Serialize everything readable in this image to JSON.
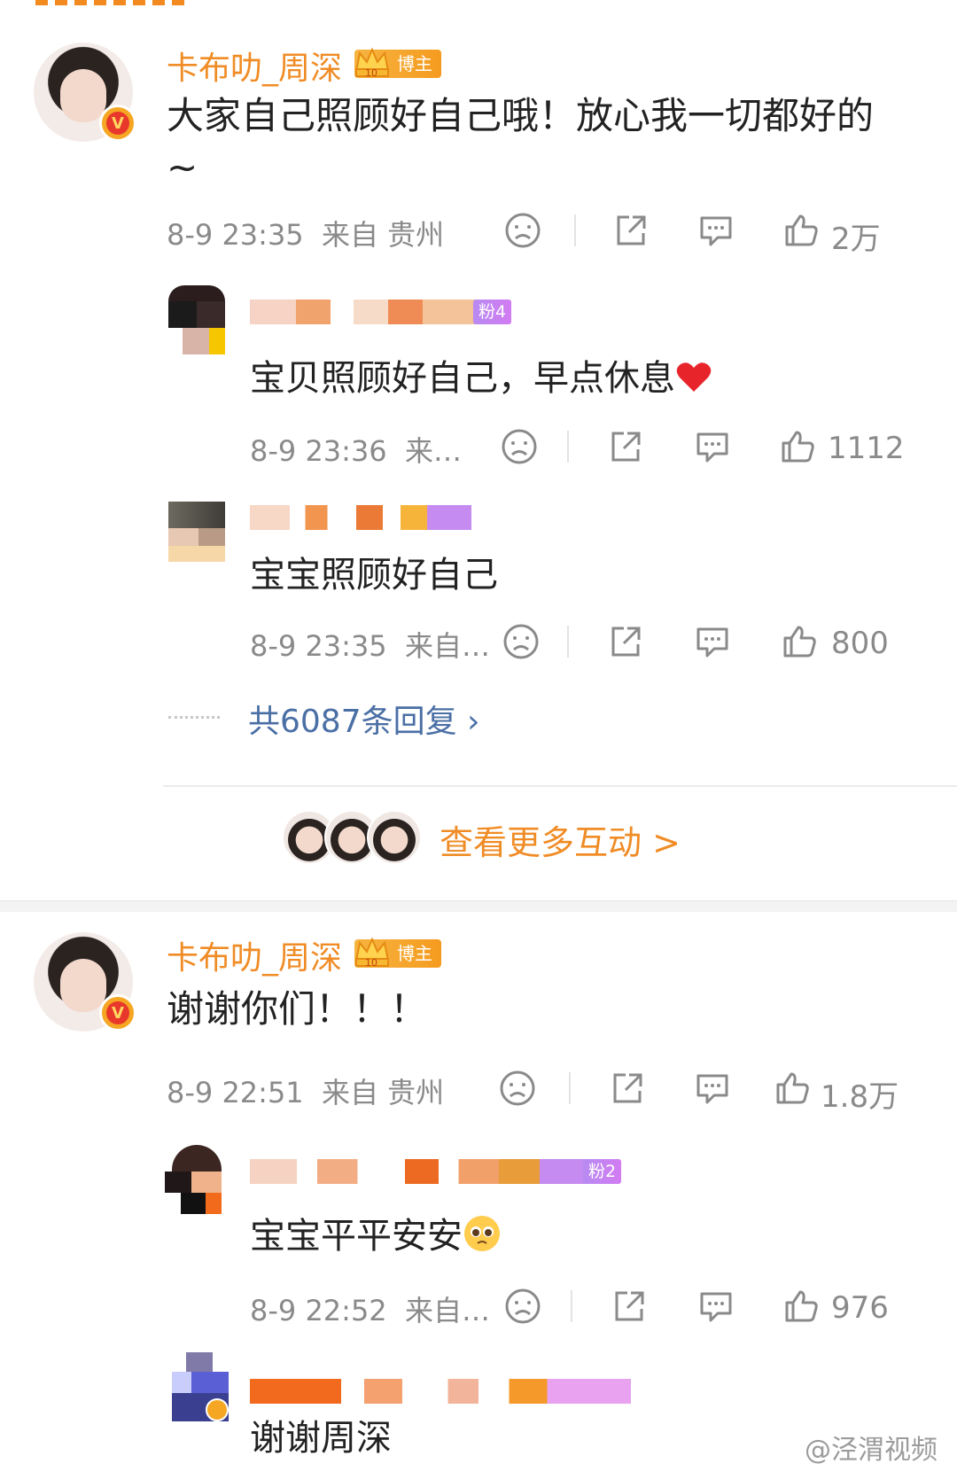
{
  "comments": [
    {
      "author": "卡布叻_周深",
      "badge": "博主",
      "badge_level": "10",
      "text": "大家自己照顾好自己哦！放心我一切都好的~",
      "time": "8-9 23:35",
      "source": "来自 贵州",
      "likes": "2万",
      "replies": [
        {
          "fan_badge": "粉4",
          "text": "宝贝照顾好自己，早点休息",
          "emoji": "heart",
          "time": "8-9 23:36",
          "source": "来…",
          "likes": "1112"
        },
        {
          "fan_badge": "",
          "text": "宝宝照顾好自己",
          "time": "8-9 23:35",
          "source": "来自…",
          "likes": "800"
        }
      ],
      "reply_total": "共6087条回复",
      "more_interactions": "查看更多互动"
    },
    {
      "author": "卡布叻_周深",
      "badge": "博主",
      "badge_level": "10",
      "text": "谢谢你们！！！",
      "time": "8-9 22:51",
      "source": "来自 贵州",
      "likes": "1.8万",
      "replies": [
        {
          "fan_badge": "粉2",
          "text": "宝宝平平安安",
          "emoji": "pleading-face",
          "time": "8-9 22:52",
          "source": "来自…",
          "likes": "976"
        },
        {
          "fan_badge": "",
          "text": "谢谢周深"
        }
      ]
    }
  ],
  "watermark": "@泾渭视频",
  "colors": {
    "accent": "#f08c26",
    "link": "#4a6fa5",
    "badge": "#f59b1f",
    "fan_badge": "#c384f2"
  }
}
